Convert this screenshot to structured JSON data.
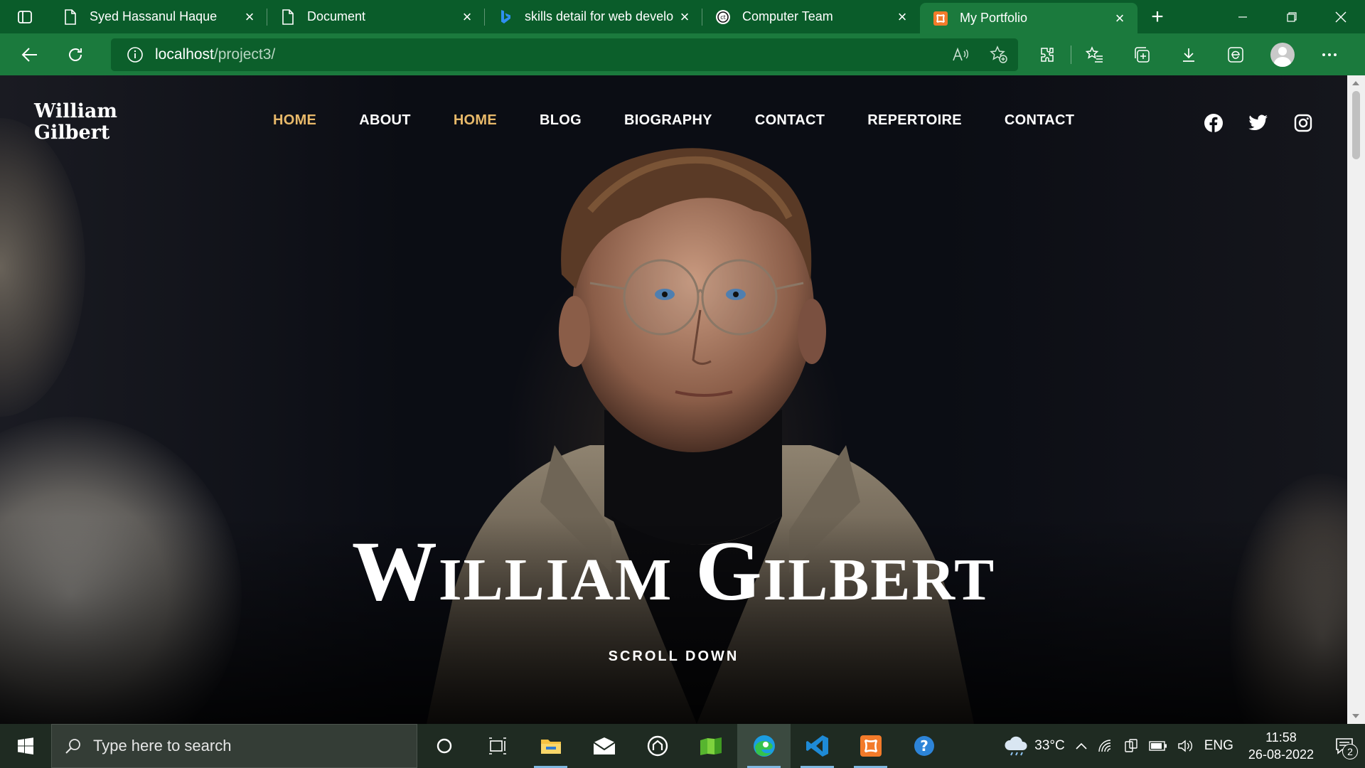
{
  "browser": {
    "tabs": [
      {
        "title": "Syed Hassanul Haque",
        "icon": "document-icon",
        "active": false
      },
      {
        "title": "Document",
        "icon": "document-icon",
        "active": false
      },
      {
        "title": "skills detail for web develo",
        "icon": "bing-icon",
        "active": false
      },
      {
        "title": "Computer Team",
        "icon": "computer-team-icon",
        "active": false
      },
      {
        "title": "My Portfolio",
        "icon": "xampp-icon",
        "active": true
      }
    ],
    "address": {
      "host": "localhost",
      "path": "/project3/"
    },
    "colors": {
      "frame": "#0a5c2a",
      "toolbar": "#1b7a3d"
    }
  },
  "site": {
    "logo_line1": "William",
    "logo_line2": "Gilbert",
    "menu": [
      "HOME",
      "ABOUT",
      "HOME",
      "BLOG",
      "BIOGRAPHY",
      "CONTACT",
      "REPERTOIRE",
      "CONTACT"
    ],
    "menu_active": [
      0,
      2
    ],
    "social": [
      "facebook-icon",
      "twitter-icon",
      "instagram-icon"
    ],
    "hero_title": "William Gilbert",
    "scroll_label": "SCROLL DOWN",
    "accent": "#e8b96a"
  },
  "taskbar": {
    "search_placeholder": "Type here to search",
    "weather": "33°C",
    "language": "ENG",
    "time": "11:58",
    "date": "26-08-2022",
    "notification_count": "2"
  }
}
